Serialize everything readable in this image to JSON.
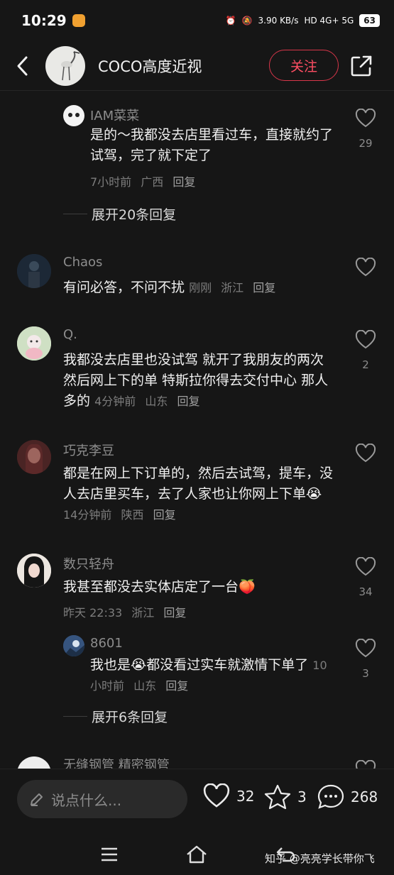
{
  "status": {
    "time": "10:29",
    "net_speed": "3.90 KB/s",
    "signal": "HD 4G+ 5G",
    "battery": "63"
  },
  "header": {
    "author": "COCO高度近视",
    "follow_label": "关注"
  },
  "comments": [
    {
      "name": "IAM菜菜",
      "text": "是的～我都没去店里看过车，直接就约了试驾，完了就下定了",
      "time": "7小时前",
      "region": "广西",
      "reply": "回复",
      "likes": "29"
    },
    {
      "expand": "展开20条回复"
    },
    {
      "name": "Chaos",
      "text": "有问必答，不问不扰",
      "time": "刚刚",
      "region": "浙江",
      "reply": "回复",
      "likes": ""
    },
    {
      "name": "Q.",
      "text": "我都没去店里也没试驾 就开了我朋友的两次  然后网上下的单  特斯拉你得去交付中心  那人多的",
      "time": "4分钟前",
      "region": "山东",
      "reply": "回复",
      "likes": "2"
    },
    {
      "name": "巧克李豆",
      "text": "都是在网上下订单的，然后去试驾，提车，没人去店里买车，去了人家也让你网上下单",
      "emoji": "😭",
      "time": "14分钟前",
      "region": "陕西",
      "reply": "回复",
      "likes": ""
    },
    {
      "name": "数只轻舟",
      "text": "我甚至都没去实体店定了一台",
      "emoji": "🍑",
      "time": "昨天 22:33",
      "region": "浙江",
      "reply": "回复",
      "likes": "34"
    },
    {
      "name": "8601",
      "text_a": "我也是",
      "emoji": "😭",
      "text_b": "都没看过实车就激情下单了",
      "time": "10小时前",
      "region": "山东",
      "reply": "回复",
      "likes": "3"
    },
    {
      "expand": "展开6条回复"
    },
    {
      "name": "无缝钢管  精密钢管"
    }
  ],
  "bottom": {
    "input_placeholder": "说点什么...",
    "likes": "32",
    "stars": "3",
    "comments": "268"
  },
  "watermark": "知乎 @亮亮学长带你飞",
  "colors": {
    "accent": "#ff4e63",
    "background": "#161616",
    "muted": "#8d8d8d"
  }
}
